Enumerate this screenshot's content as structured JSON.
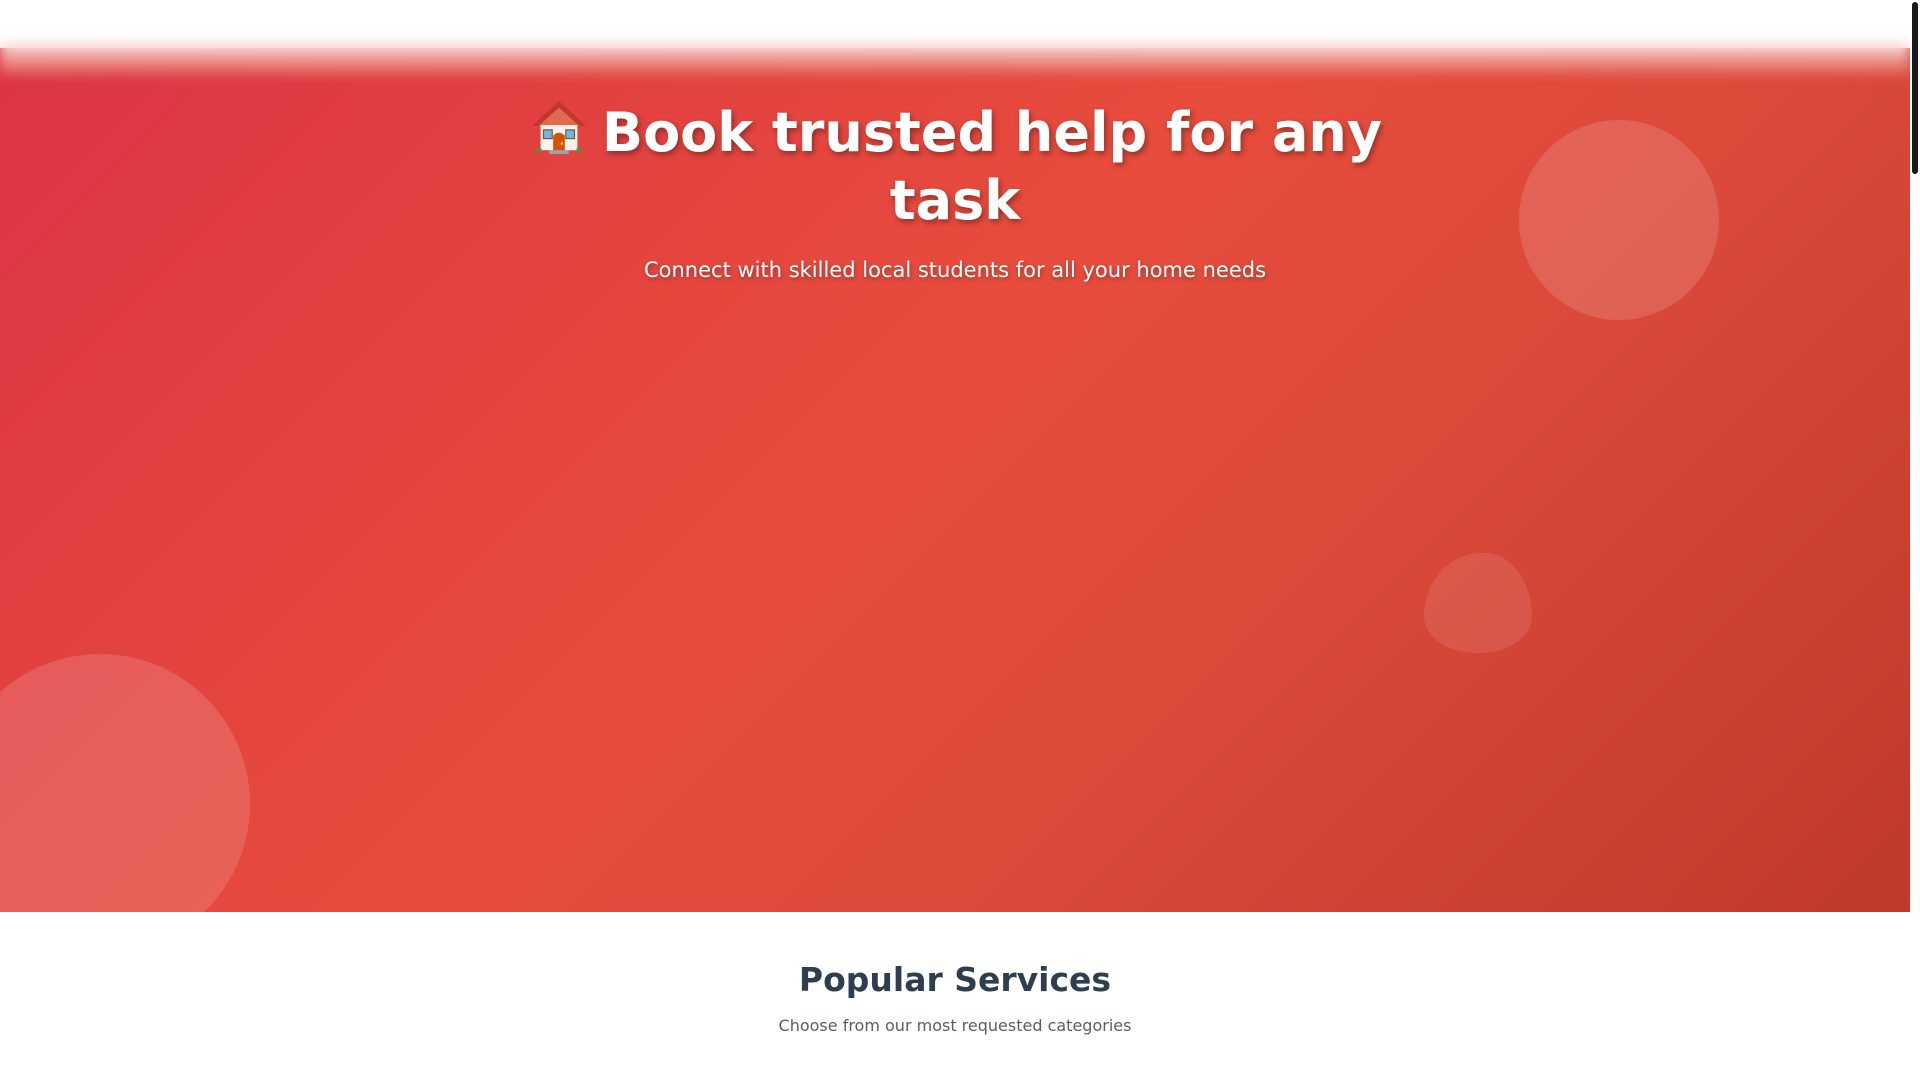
{
  "hero": {
    "icon": "house-icon",
    "title": "Book trusted help for any task",
    "subtitle": "Connect with skilled local students for all your home needs"
  },
  "services": {
    "title": "Popular Services",
    "subtitle": "Choose from our most requested categories"
  },
  "colors": {
    "hero_gradient_start": "#dc3545",
    "hero_gradient_mid": "#e74c3c",
    "hero_gradient_end": "#c0392b",
    "heading_dark": "#2c3e50",
    "text_muted": "#555f6a"
  }
}
